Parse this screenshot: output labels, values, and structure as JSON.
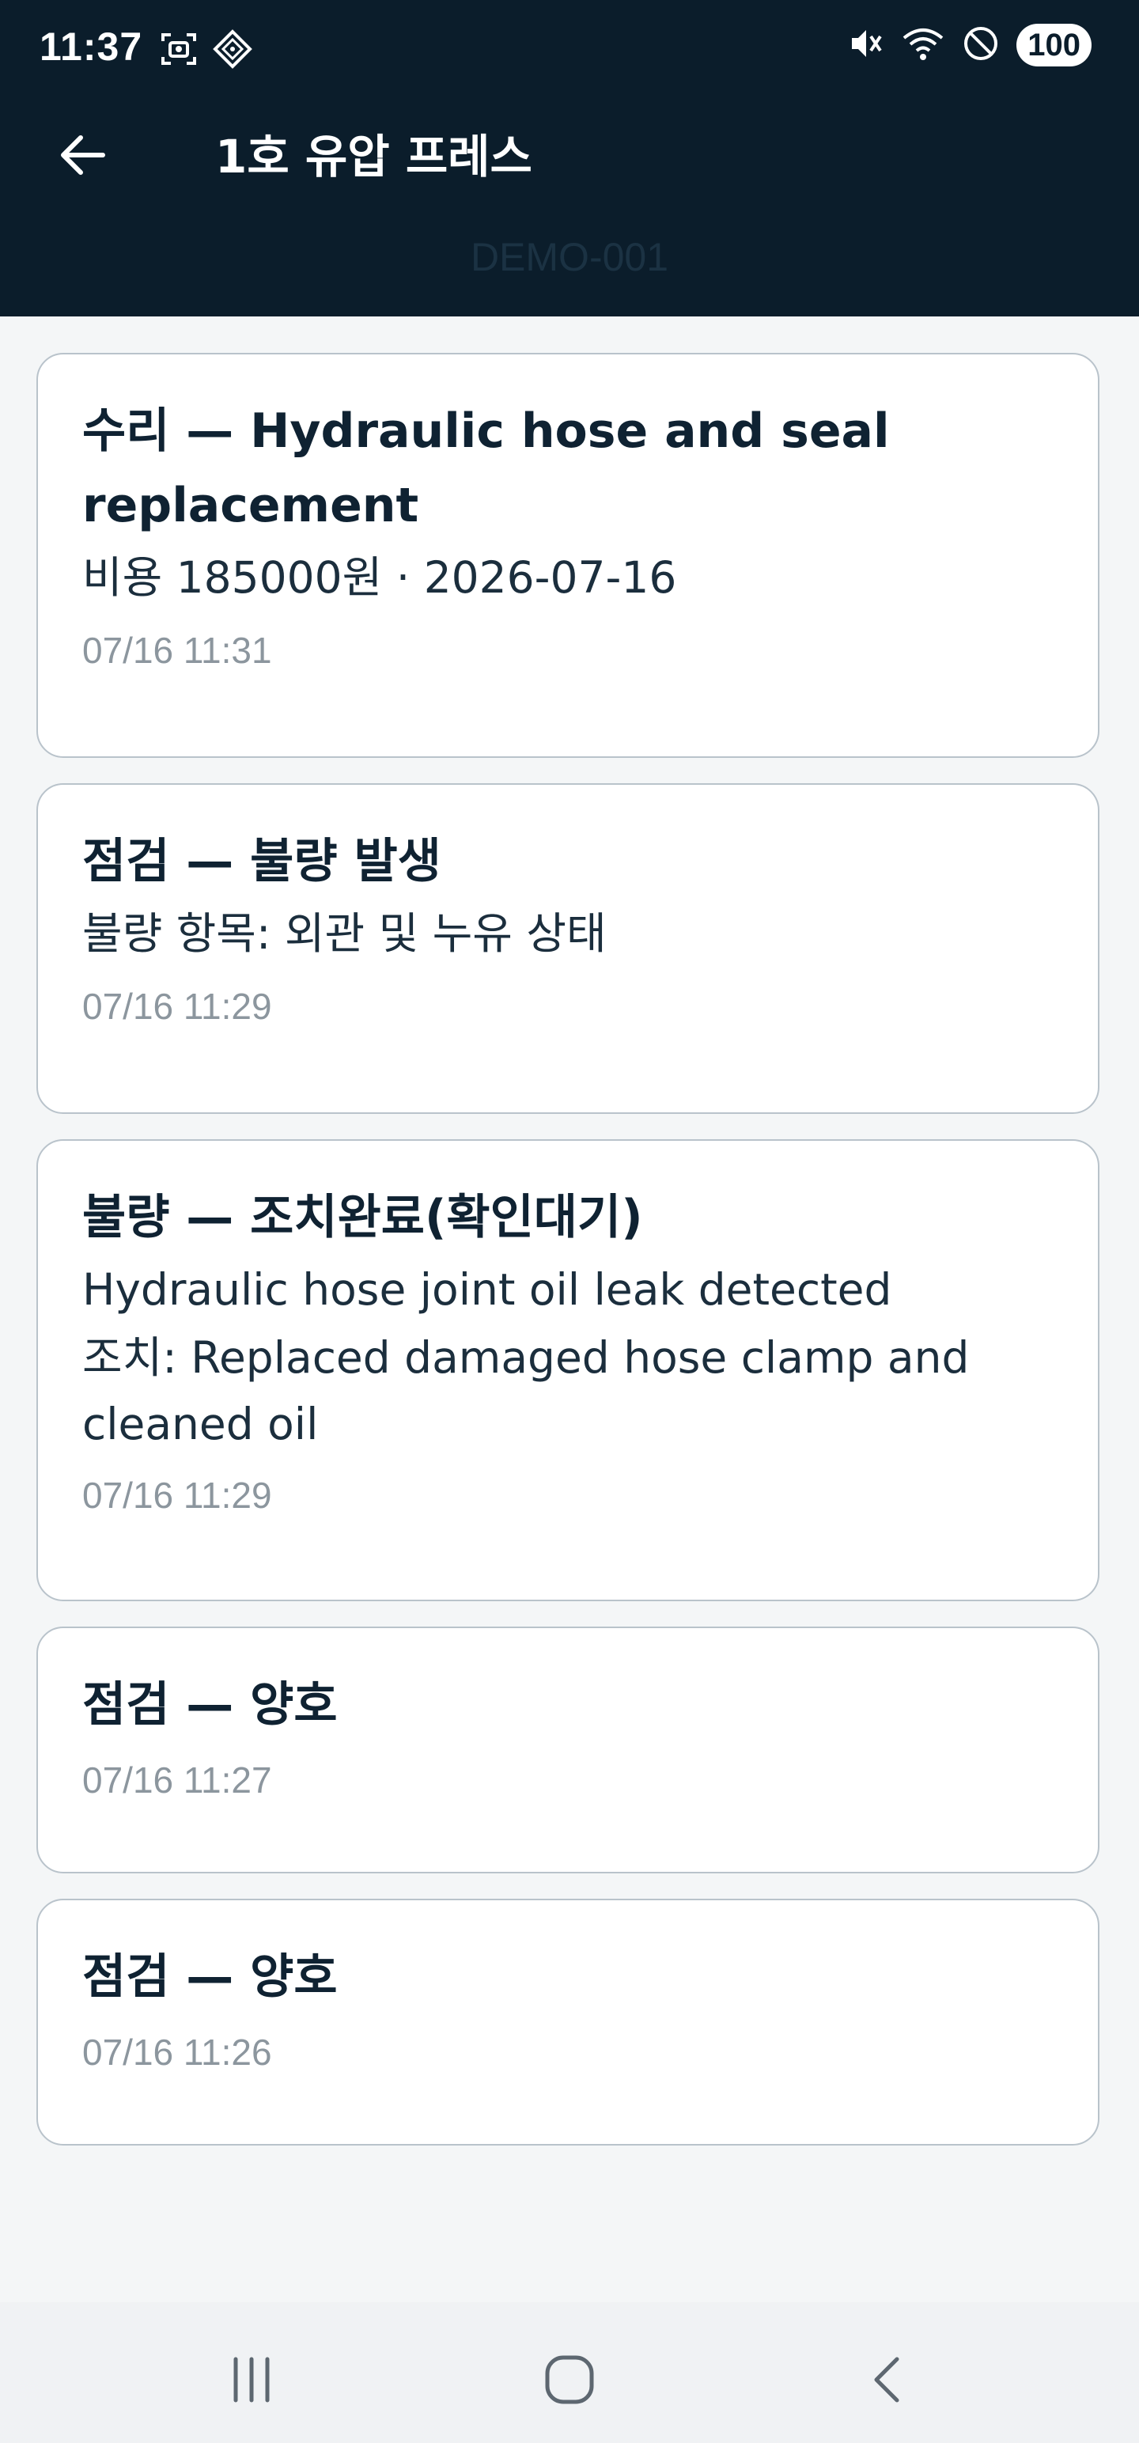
{
  "status_bar": {
    "time": "11:37",
    "battery": "100",
    "icons": [
      "screenshot-icon",
      "app-notification-icon",
      "mute-icon",
      "wifi-icon",
      "do-not-disturb-icon"
    ]
  },
  "header": {
    "title": "1호 유압 프레스",
    "subtitle": "DEMO-001",
    "back_icon": "arrow-left-icon"
  },
  "records": [
    {
      "title": "수리 — Hydraulic hose and seal replacement",
      "lines": [
        "비용 185000원 · 2026-07-16"
      ],
      "time": "07/16 11:31"
    },
    {
      "title": "점검 — 불량 발생",
      "lines": [
        "불량 항목: 외관 및 누유 상태"
      ],
      "time": "07/16 11:29"
    },
    {
      "title": "불량 — 조치완료(확인대기)",
      "lines": [
        "Hydraulic hose joint oil leak detected",
        "조치: Replaced damaged hose clamp and cleaned oil"
      ],
      "time": "07/16 11:29"
    },
    {
      "title": "점검 — 양호",
      "lines": [],
      "time": "07/16 11:27"
    },
    {
      "title": "점검 — 양호",
      "lines": [],
      "time": "07/16 11:26"
    }
  ],
  "nav": {
    "icons": [
      "recent-apps-icon",
      "home-icon",
      "back-icon"
    ]
  },
  "colors": {
    "appbar": "#0b1d2b",
    "background": "#f4f6f7",
    "card_border": "#b9c3cb",
    "timestamp": "#8c969e"
  }
}
